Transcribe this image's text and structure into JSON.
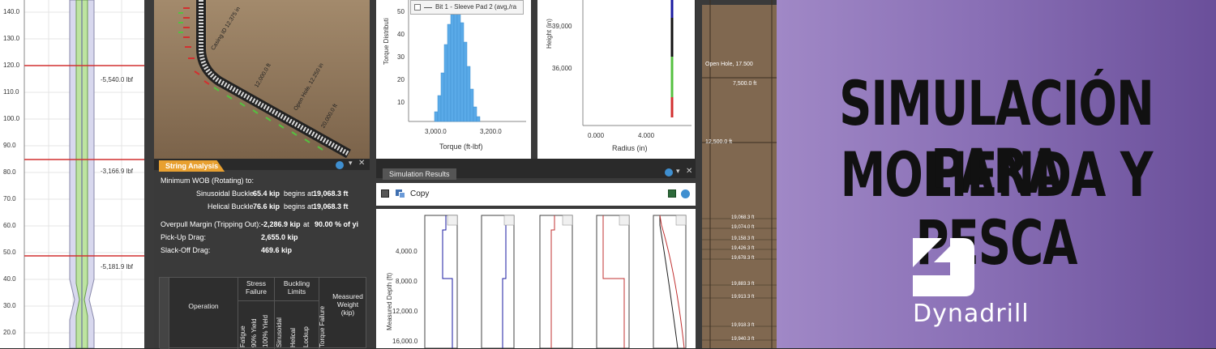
{
  "colors": {
    "banner": "#8a70b6",
    "banner_dark": "#6a4f9a",
    "accent_orange": "#e8a030",
    "red_line": "#d23030",
    "green_fill": "#bde4a0",
    "histogram": "#5aaae8"
  },
  "panel1": {
    "y_ticks": [
      "140.0",
      "130.0",
      "120.0",
      "110.0",
      "100.0",
      "90.0",
      "80.0",
      "70.0",
      "60.0",
      "50.0",
      "40.0",
      "30.0",
      "20.0"
    ],
    "labels": [
      "-5,540.0 lbf",
      "-3,166.9 lbf",
      "-5,181.9 lbf"
    ]
  },
  "panel2": {
    "labels": [
      "Casing ID 12.375 in",
      "12,000.0 ft",
      "Open Hole, 12.250 in",
      "20,000.0 ft"
    ]
  },
  "panel3": {
    "legend": "Bit 1 - Sleeve Pad 2 (avg,/ra",
    "ylabel": "Torque Distributi",
    "xlabel": "Torque (ft-lbf)",
    "y_ticks": [
      "50",
      "40",
      "30",
      "20",
      "10"
    ],
    "x_ticks": [
      "3,000.0",
      "3,200.0"
    ]
  },
  "panel4": {
    "ylabel": "Height (in)",
    "xlabel": "Radius (in)",
    "y_ticks": [
      "39,000",
      "36,000"
    ],
    "x_ticks": [
      "0.000",
      "4.000"
    ]
  },
  "panel5": {
    "tab": "String Analysis",
    "lines": {
      "min_wob": "Minimum WOB (Rotating) to:",
      "sin_label": "Sinusoidal Buckle",
      "sin_value": "65.4 kip",
      "sin_mid": "begins at",
      "sin_depth": "19,068.3 ft",
      "hel_label": "Helical Buckle",
      "hel_value": "76.6 kip",
      "hel_mid": "begins at",
      "hel_depth": "19,068.3 ft",
      "overpull_label": "Overpull Margin (Tripping Out):",
      "overpull_value": "-2,286.9 kip",
      "overpull_mid": "at",
      "overpull_pct": "90.00 % of yi",
      "pickup_label": "Pick-Up Drag:",
      "pickup_value": "2,655.0 kip",
      "slack_label": "Slack-Off Drag:",
      "slack_value": "469.6 kip"
    },
    "table": {
      "operation": "Operation",
      "stress": "Stress Failure",
      "buckling": "Buckling Limits",
      "measured": "Measured Weight (kip)",
      "sub_cols": [
        "Fatigue",
        "90% Yield",
        "100% Yield",
        "Sinusoidal",
        "Helical",
        "Lockup",
        "Torque Failure"
      ]
    }
  },
  "panel6": {
    "tab": "Simulation Results",
    "copy": "Copy",
    "ylabel": "Measured Depth (ft)",
    "y_ticks": [
      "4,000.0",
      "8,000.0",
      "12,000.0",
      "16,000.0"
    ]
  },
  "panel7": {
    "labels": [
      "Open Hole, 17.500",
      "7,500.0 ft",
      "12,500.0 ft",
      "19,068.3 ft",
      "19,074.0 ft",
      "19,158.3 ft",
      "19,426.3 ft",
      "19,678.3 ft",
      "19,883.3 ft",
      "19,913.3 ft",
      "19,918.3 ft",
      "19,940.3 ft"
    ]
  },
  "banner": {
    "line1": "SIMULACIÓN PARA",
    "line2": "MOLIENDA Y PESCA",
    "brand": "Dynadrill"
  }
}
